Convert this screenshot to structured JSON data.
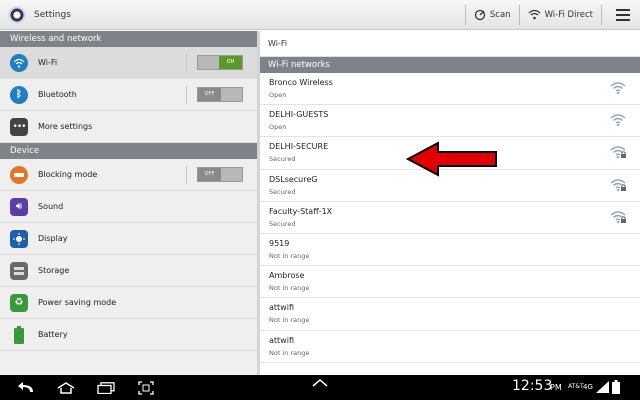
{
  "app": {
    "title": "Settings"
  },
  "toolbar": {
    "scan_label": "Scan",
    "wifi_direct_label": "Wi-Fi Direct"
  },
  "sidebar": {
    "sections": [
      {
        "title": "Wireless and network",
        "items": [
          {
            "label": "Wi-Fi",
            "icon": "wifi-icon",
            "toggle": "ON",
            "active": true
          },
          {
            "label": "Bluetooth",
            "icon": "bluetooth-icon",
            "toggle": "OFF"
          },
          {
            "label": "More settings",
            "icon": "more-icon"
          }
        ]
      },
      {
        "title": "Device",
        "items": [
          {
            "label": "Blocking mode",
            "icon": "blocking-icon",
            "toggle": "OFF"
          },
          {
            "label": "Sound",
            "icon": "sound-icon"
          },
          {
            "label": "Display",
            "icon": "display-icon"
          },
          {
            "label": "Storage",
            "icon": "storage-icon"
          },
          {
            "label": "Power saving mode",
            "icon": "power-saving-icon"
          },
          {
            "label": "Battery",
            "icon": "battery-icon"
          }
        ]
      }
    ]
  },
  "main": {
    "breadcrumb": "Wi-Fi",
    "networks_header": "Wi-Fi networks",
    "networks": [
      {
        "name": "Bronco Wireless",
        "status": "Open",
        "signal": "open"
      },
      {
        "name": "DELHI-GUESTS",
        "status": "Open",
        "signal": "open"
      },
      {
        "name": "DELHI-SECURE",
        "status": "Secured",
        "signal": "locked"
      },
      {
        "name": "DSLsecureG",
        "status": "Secured",
        "signal": "locked"
      },
      {
        "name": "Faculty-Staff-1X",
        "status": "Secured",
        "signal": "locked"
      },
      {
        "name": "9519",
        "status": "Not in range",
        "signal": "none"
      },
      {
        "name": "Ambrose",
        "status": "Not in range",
        "signal": "none"
      },
      {
        "name": "attwifi",
        "status": "Not in range",
        "signal": "none"
      },
      {
        "name": "attwifi",
        "status": "Not in range",
        "signal": "none"
      }
    ]
  },
  "colors": {
    "arrow": "#e00000",
    "section_bg": "#7d8389",
    "toggle_on": "#5a9a2a"
  },
  "statusbar": {
    "time": "12:53",
    "ampm": "PM",
    "carrier": "AT&T",
    "network": "4G"
  }
}
